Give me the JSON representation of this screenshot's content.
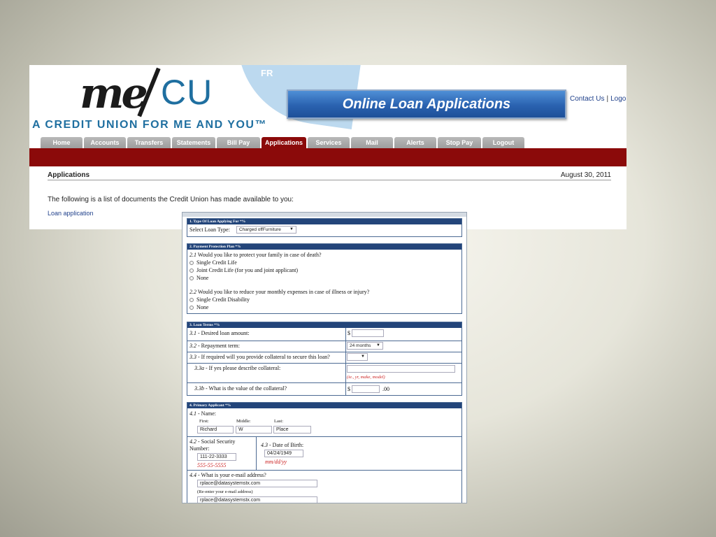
{
  "header": {
    "logo_me": "me",
    "logo_cu": "CU",
    "tagline": "A CREDIT UNION FOR ME AND YOU™",
    "swoosh_text": "FR",
    "banner_title": "Online Loan Applications",
    "contact_link": "Contact Us",
    "link_separator": "|",
    "logout_link": "Logout"
  },
  "nav": {
    "items": [
      {
        "label": "Home"
      },
      {
        "label": "Accounts"
      },
      {
        "label": "Transfers"
      },
      {
        "label": "Statements"
      },
      {
        "label": "Bill Pay"
      },
      {
        "label": "Applications"
      },
      {
        "label": "Services"
      },
      {
        "label": "Mail"
      },
      {
        "label": "Alerts"
      },
      {
        "label": "Stop Pay"
      },
      {
        "label": "Logout"
      }
    ],
    "active": "Applications"
  },
  "applications": {
    "title": "Applications",
    "date": "August 30, 2011",
    "description": "The following is a list of documents the Credit Union has made available to you:",
    "link": "Loan application"
  },
  "form": {
    "s1": {
      "head": "1. Type Of Loan Applying For *%",
      "label": "Select Loan Type:",
      "value": "Charged offFurniture"
    },
    "s2": {
      "head": "2. Payment Protection Plan *%",
      "q1_num": "2.1",
      "q1": "Would you like to protect your family in case of death?",
      "q1_opts": [
        "Single Credit Life",
        "Joint Credit Life (for you and joint applicant)",
        "None"
      ],
      "q2_num": "2.2",
      "q2": "Would you like to reduce your monthly expenses in case of illness or injury?",
      "q2_opts": [
        "Single Credit Disability",
        "None"
      ]
    },
    "s3": {
      "head": "3. Loan Terms *%",
      "r1_num": "3.1",
      "r1": "- Desired loan amount:",
      "r1_prefix": "$",
      "r2_num": "3.2",
      "r2": "- Repayment term:",
      "r2_value": "24 months",
      "r3_num": "3.3",
      "r3": "- If required will you provide collateral to secure this loan?",
      "r4_num": "3.3a",
      "r4": "- If yes please describe collateral:",
      "r4_hint": "(ie., yr, make, model)",
      "r5_num": "3.3b",
      "r5": "- What is the value of the collateral?",
      "r5_prefix": "$",
      "r5_suffix": ".00"
    },
    "s4": {
      "head": "4. Primary Applicant *%",
      "name_num": "4.1",
      "name_label": "- Name:",
      "first_label": "First:",
      "middle_label": "Middle:",
      "last_label": "Last:",
      "first": "Richard",
      "middle": "W",
      "last": "Place",
      "ssn_num": "4.2",
      "ssn_label": "- Social Security",
      "ssn_label2": "Number:",
      "ssn": "111-22-3333",
      "ssn_hint": "555-55-5555",
      "dob_num": "4.3",
      "dob_label": "- Date of Birth:",
      "dob": "04/24/1949",
      "dob_hint": "mm/dd/yy",
      "email_num": "4.4",
      "email_label": "- What is your e-mail address?",
      "email": "rplace@datasystemstx.com",
      "reenter_label": "(Re-enter your e-mail address)",
      "email2": "rplace@datasystemstx.com"
    }
  }
}
